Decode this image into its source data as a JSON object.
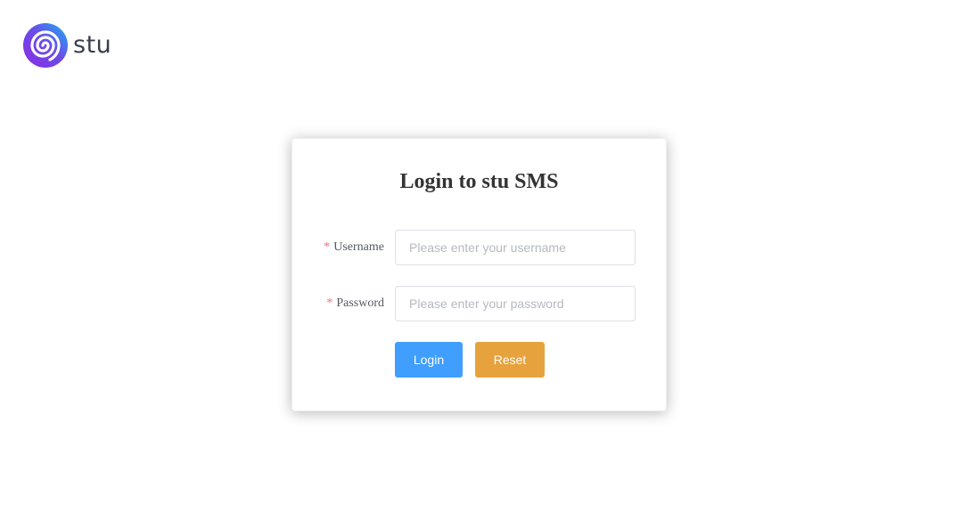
{
  "brand": {
    "name": "stu",
    "logo_icon": "spiral-logo-icon"
  },
  "login": {
    "title": "Login to stu SMS",
    "required_mark": "*",
    "username": {
      "label": "Username",
      "placeholder": "Please enter your username",
      "value": ""
    },
    "password": {
      "label": "Password",
      "placeholder": "Please enter your password",
      "value": ""
    },
    "login_button": "Login",
    "reset_button": "Reset"
  },
  "colors": {
    "primary": "#409eff",
    "warning": "#e6a23c",
    "required": "#f56c6c",
    "logo_gradient": [
      "#7b3fe4",
      "#1aa3f0"
    ]
  }
}
